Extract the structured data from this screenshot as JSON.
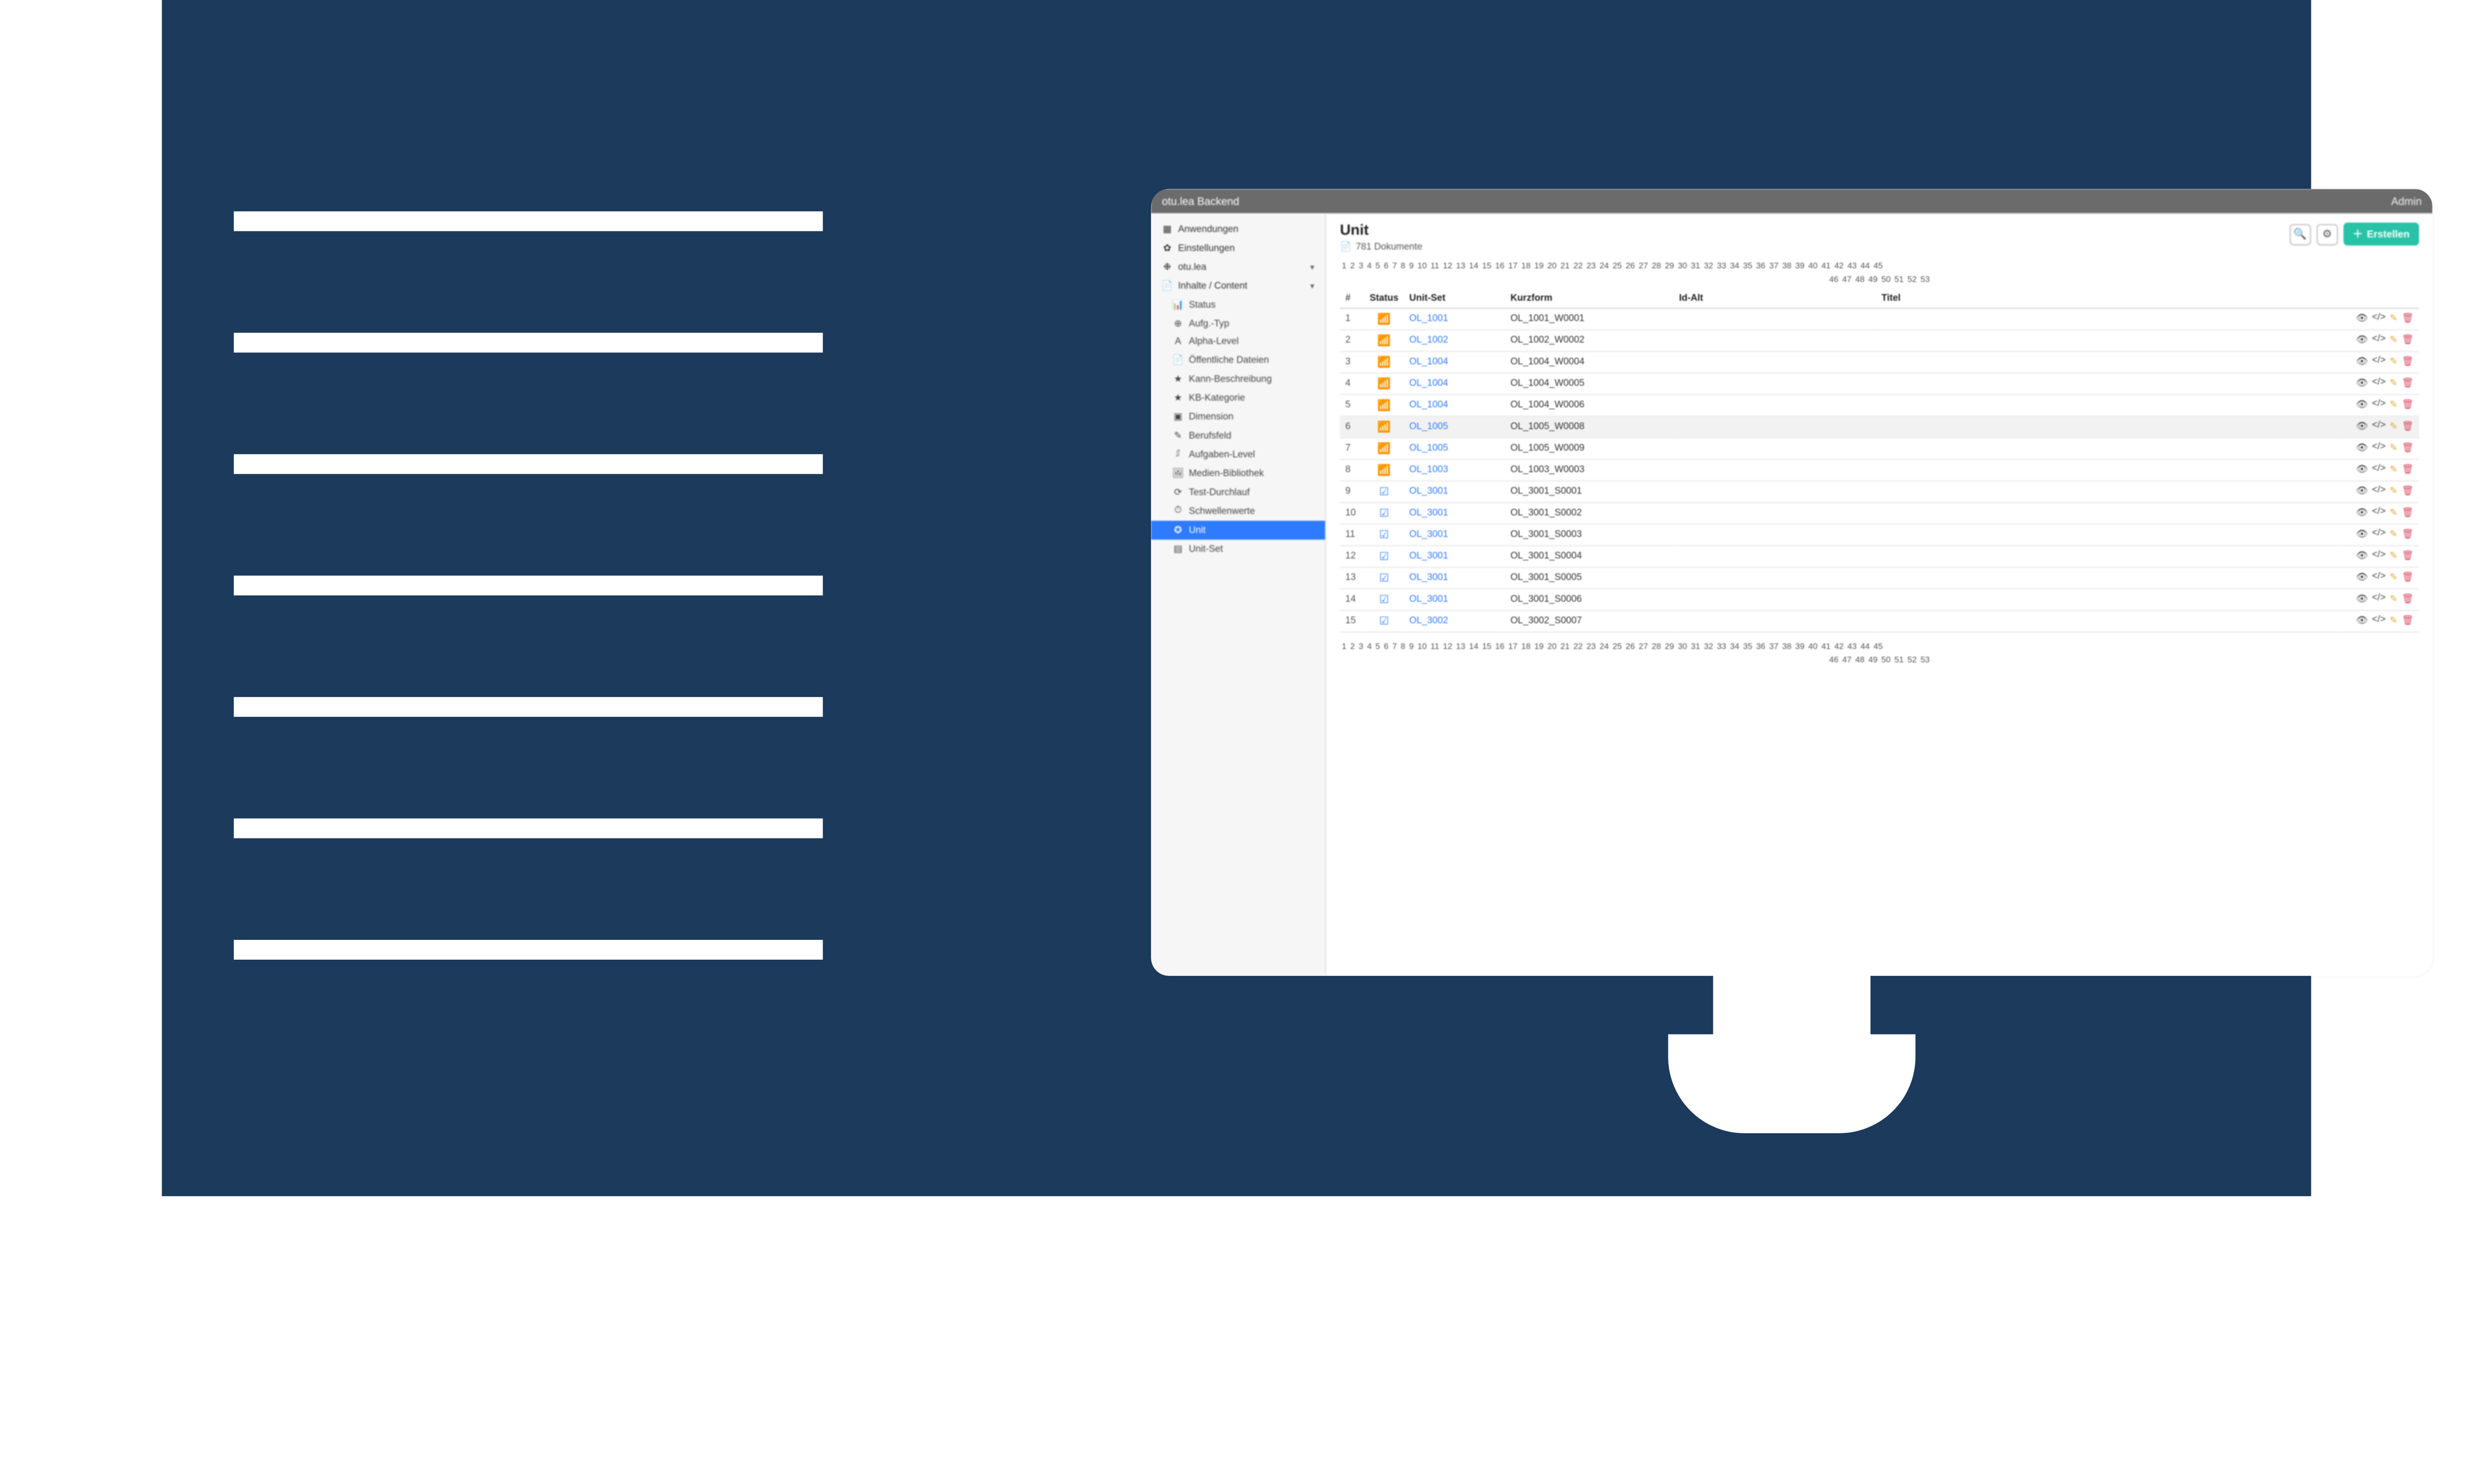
{
  "titlebar": {
    "app_name": "otu.lea Backend",
    "right_label": "Admin"
  },
  "sidebar": {
    "items": [
      {
        "icon": "▦",
        "label": "Anwendungen"
      },
      {
        "icon": "✿",
        "label": "Einstellungen"
      },
      {
        "icon": "❉",
        "label": "otu.lea",
        "caret": "▾"
      },
      {
        "icon": "📄",
        "label": "Inhalte / Content",
        "caret": "▾"
      }
    ],
    "content_items": [
      {
        "icon": "📊",
        "label": "Status"
      },
      {
        "icon": "⊕",
        "label": "Aufg.-Typ"
      },
      {
        "icon": "A",
        "label": "Alpha-Level"
      },
      {
        "icon": "📄",
        "label": "Öffentliche Dateien"
      },
      {
        "icon": "★",
        "label": "Kann-Beschreibung"
      },
      {
        "icon": "★",
        "label": "KB-Kategorie"
      },
      {
        "icon": "▣",
        "label": "Dimension"
      },
      {
        "icon": "✎",
        "label": "Berufsfeld"
      },
      {
        "icon": "⎎",
        "label": "Aufgaben-Level"
      },
      {
        "icon": "🖼",
        "label": "Medien-Bibliothek"
      },
      {
        "icon": "⟳",
        "label": "Test-Durchlauf"
      },
      {
        "icon": "⏱",
        "label": "Schwellenwerte"
      },
      {
        "icon": "✪",
        "label": "Unit",
        "active": true
      },
      {
        "icon": "▤",
        "label": "Unit-Set"
      }
    ]
  },
  "header": {
    "title": "Unit",
    "doc_count_label": "781 Dokumente",
    "create_label": "Erstellen",
    "search_icon": "search",
    "gear_icon": "gear"
  },
  "pagination": {
    "row1": [
      1,
      2,
      3,
      4,
      5,
      6,
      7,
      8,
      9,
      10,
      11,
      12,
      13,
      14,
      15,
      16,
      17,
      18,
      19,
      20,
      21,
      22,
      23,
      24,
      25,
      26,
      27,
      28,
      29,
      30,
      31,
      32,
      33,
      34,
      35,
      36,
      37,
      38,
      39,
      40,
      41,
      42,
      43,
      44,
      45
    ],
    "row2": [
      46,
      47,
      48,
      49,
      50,
      51,
      52,
      53
    ]
  },
  "table": {
    "columns": {
      "idx": "#",
      "status": "Status",
      "set": "Unit-Set",
      "kurz": "Kurzform",
      "idalt": "Id-Alt",
      "titel": "Titel"
    },
    "rows": [
      {
        "i": 1,
        "status": "green",
        "set": "OL_1001",
        "kurz": "OL_1001_W0001",
        "idalt": "",
        "titel": ""
      },
      {
        "i": 2,
        "status": "green",
        "set": "OL_1002",
        "kurz": "OL_1002_W0002",
        "idalt": "",
        "titel": ""
      },
      {
        "i": 3,
        "status": "green",
        "set": "OL_1004",
        "kurz": "OL_1004_W0004",
        "idalt": "",
        "titel": ""
      },
      {
        "i": 4,
        "status": "green",
        "set": "OL_1004",
        "kurz": "OL_1004_W0005",
        "idalt": "",
        "titel": ""
      },
      {
        "i": 5,
        "status": "green",
        "set": "OL_1004",
        "kurz": "OL_1004_W0006",
        "idalt": "",
        "titel": ""
      },
      {
        "i": 6,
        "status": "green",
        "set": "OL_1005",
        "kurz": "OL_1005_W0008",
        "idalt": "",
        "titel": "",
        "hover": true
      },
      {
        "i": 7,
        "status": "green",
        "set": "OL_1005",
        "kurz": "OL_1005_W0009",
        "idalt": "",
        "titel": ""
      },
      {
        "i": 8,
        "status": "green",
        "set": "OL_1003",
        "kurz": "OL_1003_W0003",
        "idalt": "",
        "titel": ""
      },
      {
        "i": 9,
        "status": "blue",
        "set": "OL_3001",
        "kurz": "OL_3001_S0001",
        "idalt": "",
        "titel": ""
      },
      {
        "i": 10,
        "status": "blue",
        "set": "OL_3001",
        "kurz": "OL_3001_S0002",
        "idalt": "",
        "titel": ""
      },
      {
        "i": 11,
        "status": "blue",
        "set": "OL_3001",
        "kurz": "OL_3001_S0003",
        "idalt": "",
        "titel": ""
      },
      {
        "i": 12,
        "status": "blue",
        "set": "OL_3001",
        "kurz": "OL_3001_S0004",
        "idalt": "",
        "titel": ""
      },
      {
        "i": 13,
        "status": "blue",
        "set": "OL_3001",
        "kurz": "OL_3001_S0005",
        "idalt": "",
        "titel": ""
      },
      {
        "i": 14,
        "status": "blue",
        "set": "OL_3001",
        "kurz": "OL_3001_S0006",
        "idalt": "",
        "titel": ""
      },
      {
        "i": 15,
        "status": "blue",
        "set": "OL_3002",
        "kurz": "OL_3002_S0007",
        "idalt": "",
        "titel": ""
      }
    ]
  },
  "icons": {
    "search": "🔍",
    "gear": "⚙",
    "plus": "＋",
    "doc": "📄",
    "eye": "👁",
    "code": "</>",
    "edit": "✎",
    "trash": "🗑",
    "chart_green": "▮",
    "chart_blue": "☑"
  }
}
